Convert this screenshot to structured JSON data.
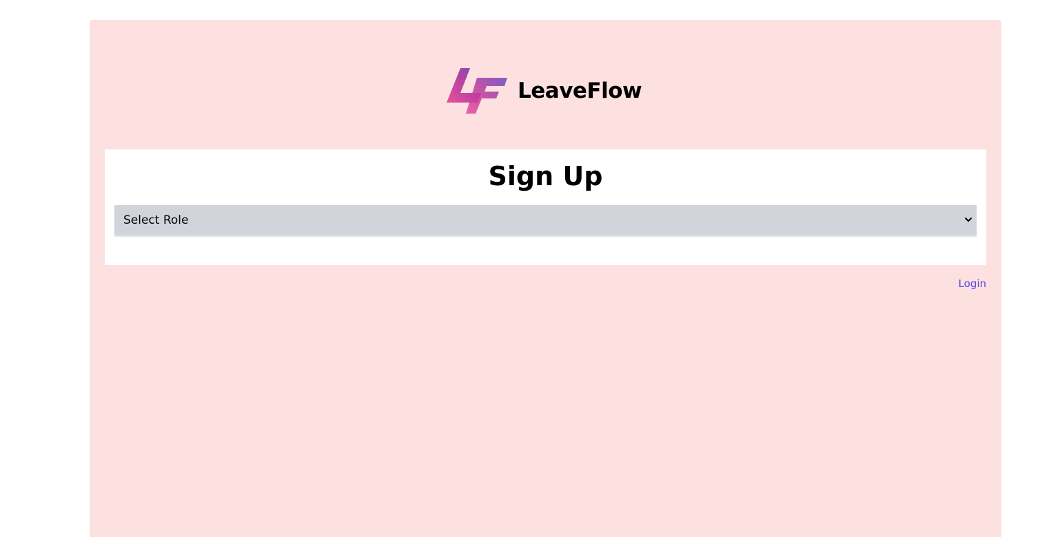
{
  "brand": {
    "name": "LeaveFlow",
    "logo_icon": "lf-logo-icon",
    "logo_colors": [
      "#ec4899",
      "#7e3fb8",
      "#6b46c1"
    ]
  },
  "signup": {
    "title": "Sign Up",
    "role_select": {
      "selected": "Select Role",
      "icon": "chevron-down-icon"
    }
  },
  "login_link": "Login",
  "colors": {
    "panel_background": "#fde0e0",
    "card_background": "#ffffff",
    "select_background": "#d1d5db",
    "link": "#4f46e5"
  }
}
